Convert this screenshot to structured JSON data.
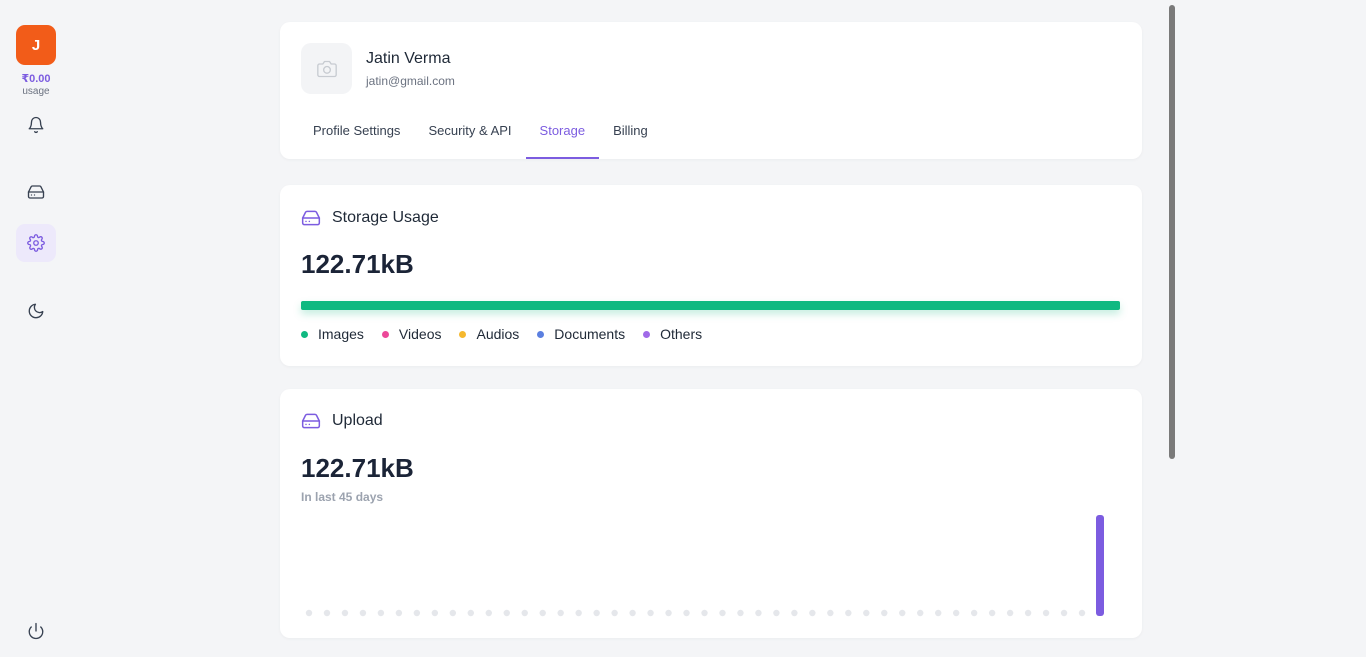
{
  "sidebar": {
    "avatar_initial": "J",
    "usage_amount": "₹0.00",
    "usage_label": "usage",
    "icons": [
      "bell-icon",
      "hard-drive-icon",
      "gear-icon",
      "moon-icon",
      "power-icon"
    ],
    "active_item": "settings",
    "accent_color": "#7c5ce0",
    "avatar_color": "#f25c19"
  },
  "profile": {
    "name": "Jatin Verma",
    "email": "jatin@gmail.com",
    "photo_icon": "camera-icon",
    "tabs": [
      {
        "label": "Profile Settings",
        "active": false
      },
      {
        "label": "Security & API",
        "active": false
      },
      {
        "label": "Storage",
        "active": true
      },
      {
        "label": "Billing",
        "active": false
      }
    ]
  },
  "storage": {
    "title": "Storage Usage",
    "value": "122.71kB",
    "icon": "hard-drive-icon",
    "fill_percent": 100,
    "fill_color": "#10b981",
    "legend": [
      {
        "label": "Images",
        "color": "#10b981"
      },
      {
        "label": "Videos",
        "color": "#ec4899"
      },
      {
        "label": "Audios",
        "color": "#f5b82e"
      },
      {
        "label": "Documents",
        "color": "#5b7fe0"
      },
      {
        "label": "Others",
        "color": "#a06ae8"
      }
    ]
  },
  "upload": {
    "title": "Upload",
    "value": "122.71kB",
    "subtitle": "In last 45 days",
    "icon": "hard-drive-icon",
    "chart_data": {
      "type": "bar",
      "bar_count": 45,
      "values": [
        0,
        0,
        0,
        0,
        0,
        0,
        0,
        0,
        0,
        0,
        0,
        0,
        0,
        0,
        0,
        0,
        0,
        0,
        0,
        0,
        0,
        0,
        0,
        0,
        0,
        0,
        0,
        0,
        0,
        0,
        0,
        0,
        0,
        0,
        0,
        0,
        0,
        0,
        0,
        0,
        0,
        0,
        0,
        0,
        1
      ],
      "bar_color": "#7c5ce0",
      "empty_color": "#e5e7eb"
    }
  }
}
